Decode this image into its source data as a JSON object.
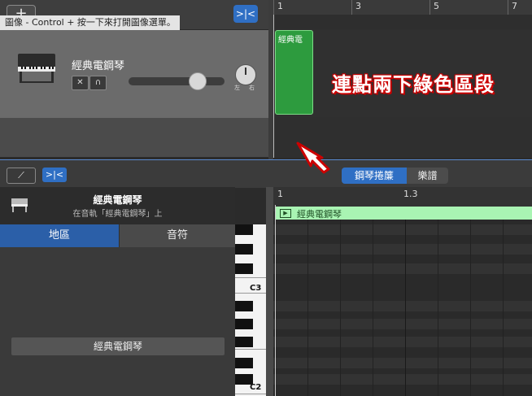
{
  "top": {
    "add_label": "+",
    "filter_label": ">|<",
    "tooltip": "圖像 - Control + 按一下來打開圖像選單。",
    "track": {
      "name": "經典電鋼琴",
      "mute_label": "🔇",
      "headphone_label": "🎧",
      "pan_left": "左",
      "pan_right": "右"
    },
    "ruler": [
      "1",
      "3",
      "5",
      "7"
    ],
    "region_title": "經典電",
    "callout": "連點兩下綠色區段"
  },
  "editor": {
    "catch_label": "⟋",
    "filter_label": ">|<",
    "tabs": [
      "鋼琴捲簾",
      "樂譜"
    ],
    "active_tab": "鋼琴捲簾",
    "inspector": {
      "title": "經典電鋼琴",
      "subtitle": "在音軌「經典電鋼琴」上",
      "tab_region": "地區",
      "tab_note": "音符",
      "region_name": "經典電鋼琴"
    },
    "keyboard_labels": [
      "C3",
      "C2"
    ],
    "ruler": [
      "1",
      "1.3"
    ],
    "region_title": "經典電鋼琴"
  },
  "colors": {
    "accent": "#2f6fc4",
    "region_green": "#2d9b3e",
    "region_light": "#a9f4b3",
    "callout_outline": "#cc0000"
  }
}
